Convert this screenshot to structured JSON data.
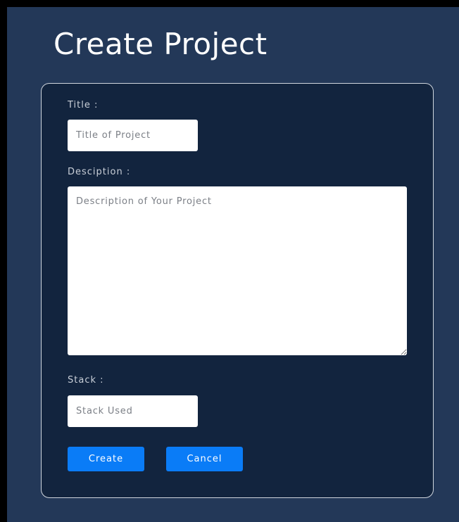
{
  "page": {
    "title": "Create Project"
  },
  "form": {
    "title_label": "Title :",
    "title_placeholder": "Title of Project",
    "title_value": "",
    "description_label": "Desciption :",
    "description_placeholder": "Description of Your Project",
    "description_value": "",
    "stack_label": "Stack :",
    "stack_placeholder": "Stack Used",
    "stack_value": "",
    "create_label": "Create",
    "cancel_label": "Cancel"
  },
  "colors": {
    "background": "#233858",
    "card": "#12243e",
    "accent": "#0a7cf7"
  }
}
